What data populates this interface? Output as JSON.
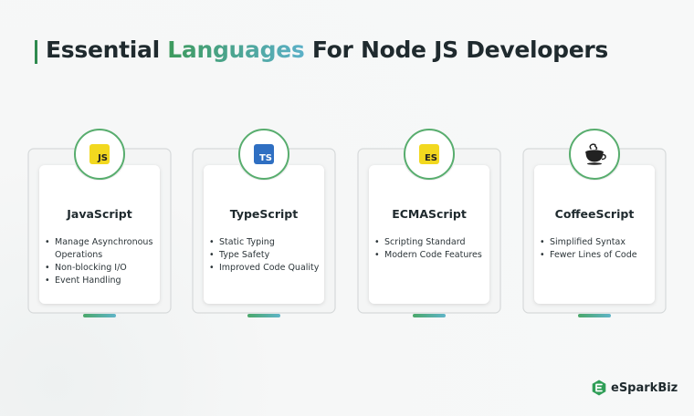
{
  "header": {
    "title_pre": "Essential ",
    "title_highlight": "Languages",
    "title_post": " For Node JS Developers"
  },
  "cards": [
    {
      "name": "JavaScript",
      "icon": "js-badge-icon",
      "icon_text": "JS",
      "points": [
        "Manage Asynchronous Operations",
        "Non-blocking I/O",
        "Event Handling"
      ]
    },
    {
      "name": "TypeScript",
      "icon": "ts-badge-icon",
      "icon_text": "TS",
      "points": [
        "Static Typing",
        "Type Safety",
        "Improved Code Quality"
      ]
    },
    {
      "name": "ECMAScript",
      "icon": "es-badge-icon",
      "icon_text": "ES",
      "points": [
        "Scripting Standard",
        "Modern Code Features"
      ]
    },
    {
      "name": "CoffeeScript",
      "icon": "coffee-cup-icon",
      "icon_text": "",
      "points": [
        "Simplified Syntax",
        "Fewer Lines of Code"
      ]
    }
  ],
  "brand": {
    "name": "eSparkBiz",
    "logo_icon": "esparkbiz-logo-icon"
  },
  "colors": {
    "accent_green": "#3d9a5c",
    "accent_teal": "#5bb0c8",
    "text_dark": "#1f2a2e"
  }
}
